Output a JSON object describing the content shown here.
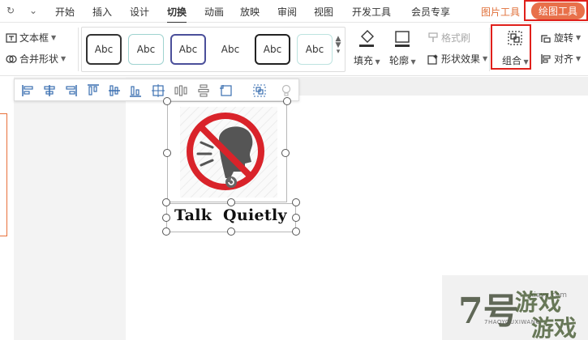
{
  "menubar": {
    "redo_icon": "redo-icon",
    "more_icon": "chevron-down-icon",
    "tabs": [
      "开始",
      "插入",
      "设计",
      "切换",
      "动画",
      "放映",
      "审阅",
      "视图",
      "开发工具",
      "会员专享"
    ],
    "active_tab": "切换",
    "picture_tools": "图片工具",
    "drawing_tools": "绘图工具"
  },
  "ribbon": {
    "text_box": "文本框",
    "merge_shapes": "合并形状",
    "style_samples": [
      "Abc",
      "Abc",
      "Abc",
      "Abc",
      "Abc",
      "Abc"
    ],
    "fill": "填充",
    "outline": "轮廓",
    "format_painter": "格式刷",
    "shape_effects": "形状效果",
    "group": "组合",
    "rotate": "旋转",
    "align": "对齐"
  },
  "slide": {
    "caption": "Talk  Quietly"
  },
  "watermark": {
    "number": "7号",
    "name_line1": "游戏",
    "name_line2": "游戏",
    "pinyin": "7HAOYOUXIWANG",
    "url": "xiayx.com"
  },
  "colors": {
    "accent": "#e8704a",
    "highlight": "#e0201b",
    "no_sign": "#d9232a"
  }
}
